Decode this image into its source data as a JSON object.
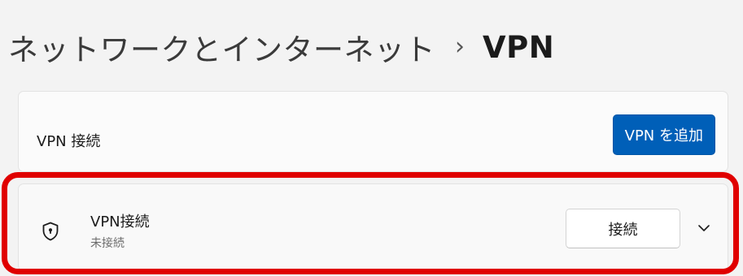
{
  "breadcrumb": {
    "parent": "ネットワークとインターネット",
    "separator": "›",
    "current": "VPN"
  },
  "vpn_section": {
    "label": "VPN 接続",
    "add_button_label": "VPN を追加"
  },
  "connection": {
    "name": "VPN接続",
    "status": "未接続",
    "connect_button_label": "接続",
    "icon": "shield-icon"
  },
  "colors": {
    "accent": "#005fb8",
    "highlight": "#e00000",
    "background": "#f3f3f3"
  }
}
